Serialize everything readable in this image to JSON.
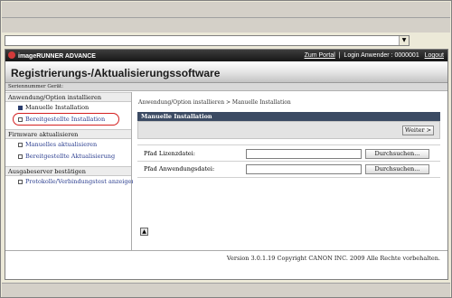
{
  "header": {
    "brand": "imageRUNNER ADVANCE",
    "portal_link": "Zum Portal",
    "login_text": "Login Anwender : 0000001",
    "logout_link": "Logout",
    "page_title": "Registrierungs-/Aktualisierungssoftware",
    "device_label": "Seriennummer Gerät:"
  },
  "sidebar": {
    "sections": [
      {
        "heading": "Anwendung/Option installieren",
        "items": [
          {
            "label": "Manuelle Installation"
          },
          {
            "label": "Bereitgestellte Installation"
          }
        ]
      },
      {
        "heading": "Firmware aktualisieren",
        "items": [
          {
            "label": "Manuelles aktualisieren"
          },
          {
            "label": "Bereitgestellte Aktualisierung"
          }
        ]
      },
      {
        "heading": "Ausgabeserver bestätigen",
        "items": [
          {
            "label": "Protokolle/Verbindungstest anzeigen"
          }
        ]
      }
    ]
  },
  "main": {
    "breadcrumb": "Anwendung/Option installieren > Manuelle Installation",
    "panel_title": "Manuelle Installation",
    "next_button": "Weiter >",
    "fields": [
      {
        "label": "Pfad Lizenzdatei:",
        "value": "",
        "button": "Durchsuchen..."
      },
      {
        "label": "Pfad Anwendungsdatei:",
        "value": "",
        "button": "Durchsuchen..."
      }
    ]
  },
  "footer": {
    "text": "Version 3.0.1.19 Copyright CANON INC. 2009 Alle Rechte vorbehalten."
  },
  "colors": {
    "topbar": "#161616",
    "panel_header": "#3b4a63",
    "link": "#2a3d8f",
    "highlight_ring": "#d42020"
  }
}
